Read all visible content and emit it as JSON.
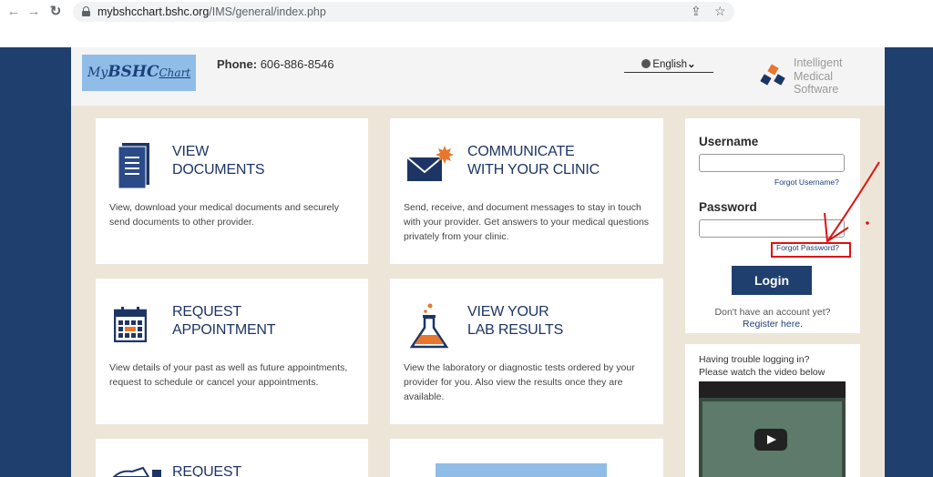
{
  "browser": {
    "back_icon": "←",
    "forward_icon": "→",
    "reload_icon": "↻",
    "url_host": "mybshcchart.bshc.org",
    "url_path": "/IMS/general/index.php",
    "share_icon": "⇪",
    "star_icon": "☆"
  },
  "header": {
    "logo": {
      "my": "My",
      "bshc": "BSHC",
      "chart": "Chart"
    },
    "phone_label": "Phone:",
    "phone_number": "606-886-8546",
    "language": "English",
    "language_arrow": "⌄",
    "ims_logo": [
      "Intelligent",
      "Medical",
      "Software"
    ]
  },
  "cards": [
    {
      "title": [
        "VIEW",
        "DOCUMENTS"
      ],
      "desc": "View, download your medical documents and securely send documents to other provider."
    },
    {
      "title": [
        "COMMUNICATE",
        "WITH YOUR CLINIC"
      ],
      "desc": "Send, receive, and document messages to stay in touch with your provider. Get answers to your medical questions privately from your clinic."
    },
    {
      "title": [
        "REQUEST",
        "APPOINTMENT"
      ],
      "desc": "View details of your past as well as future appointments, request to schedule or cancel your appointments."
    },
    {
      "title": [
        "VIEW YOUR",
        "LAB RESULTS"
      ],
      "desc": "View the laboratory or diagnostic tests ordered by your provider for you. Also view the results once they are available."
    },
    {
      "title": [
        "REQUEST"
      ],
      "desc": ""
    }
  ],
  "login": {
    "username_label": "Username",
    "username_value": "",
    "forgot_username": "Forgot Username?",
    "password_label": "Password",
    "password_value": "",
    "forgot_password": "Forgot Password?",
    "login_button": "Login",
    "no_account": "Don't have an account yet?",
    "register": "Register here."
  },
  "video": {
    "line1": "Having trouble logging in?",
    "line2": "Please watch the video below"
  },
  "colors": {
    "navy": "#1d3565",
    "orange": "#e8772e",
    "annotation_red": "#e01010",
    "background_blue": "#1f3f6e"
  }
}
